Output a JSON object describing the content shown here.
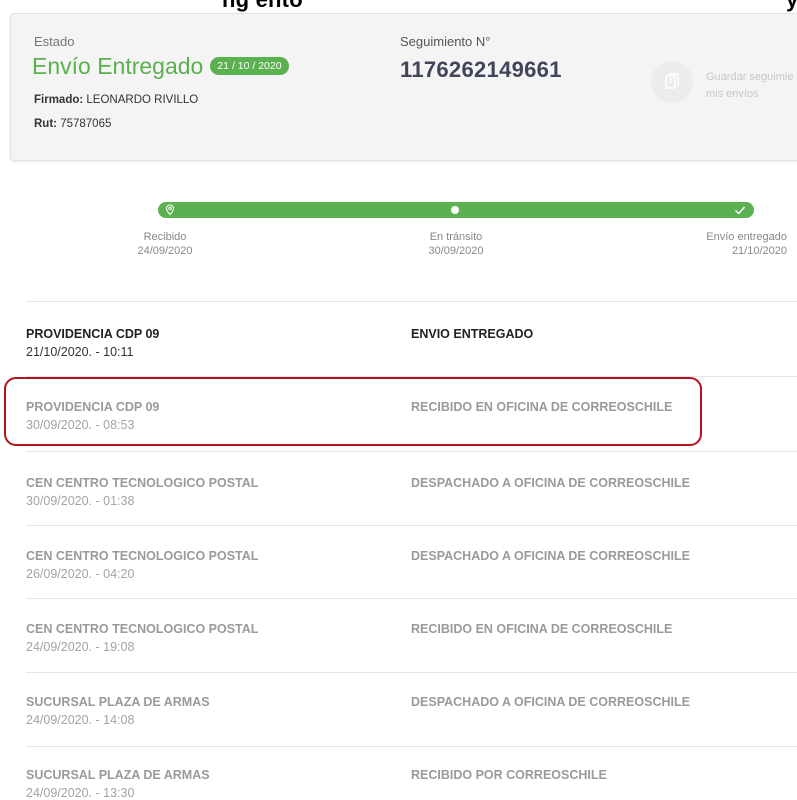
{
  "header_strip": {
    "text": "ng ento",
    "trail": "y"
  },
  "status": {
    "estado_label": "Estado",
    "estado_value": "Envío Entregado",
    "date_badge": "21 / 10 / 2020",
    "signed_label": "Firmado:",
    "signed_value": "LEONARDO RIVILLO",
    "rut_label": "Rut:",
    "rut_value": "75787065",
    "tracking_label": "Seguimiento N°",
    "tracking_number": "1176262149661",
    "save_line1": "Guardar seguimie",
    "save_line2": "mis envíos",
    "save_icon": "bookmark-icon"
  },
  "progress": {
    "completed_fraction": 1,
    "color": "#5bb04f",
    "steps": [
      {
        "label": "Recibido",
        "date": "24/09/2020",
        "icon": "location-pin-icon"
      },
      {
        "label": "En tránsito",
        "date": "30/09/2020",
        "icon": "dot-icon"
      },
      {
        "label": "Envío entregado",
        "date": "21/10/2020",
        "icon": "check-icon"
      }
    ]
  },
  "events": [
    {
      "place": "PROVIDENCIA CDP 09",
      "time": "21/10/2020. - 10:11",
      "status": "ENVIO ENTREGADO"
    },
    {
      "place": "PROVIDENCIA CDP 09",
      "time": "30/09/2020. - 08:53",
      "status": "RECIBIDO EN OFICINA DE CORREOSCHILE"
    },
    {
      "place": "CEN CENTRO TECNOLOGICO POSTAL",
      "time": "30/09/2020. - 01:38",
      "status": "DESPACHADO A OFICINA DE CORREOSCHILE"
    },
    {
      "place": "CEN CENTRO TECNOLOGICO POSTAL",
      "time": "26/09/2020. - 04:20",
      "status": "DESPACHADO A OFICINA DE CORREOSCHILE"
    },
    {
      "place": "CEN CENTRO TECNOLOGICO POSTAL",
      "time": "24/09/2020. - 19:08",
      "status": "RECIBIDO EN OFICINA DE CORREOSCHILE"
    },
    {
      "place": "SUCURSAL PLAZA DE ARMAS",
      "time": "24/09/2020. - 14:08",
      "status": "DESPACHADO A OFICINA DE CORREOSCHILE"
    },
    {
      "place": "SUCURSAL PLAZA DE ARMAS",
      "time": "24/09/2020. - 13:30",
      "status": "RECIBIDO POR CORREOSCHILE"
    }
  ],
  "highlight": {
    "color": "#b3141c"
  }
}
